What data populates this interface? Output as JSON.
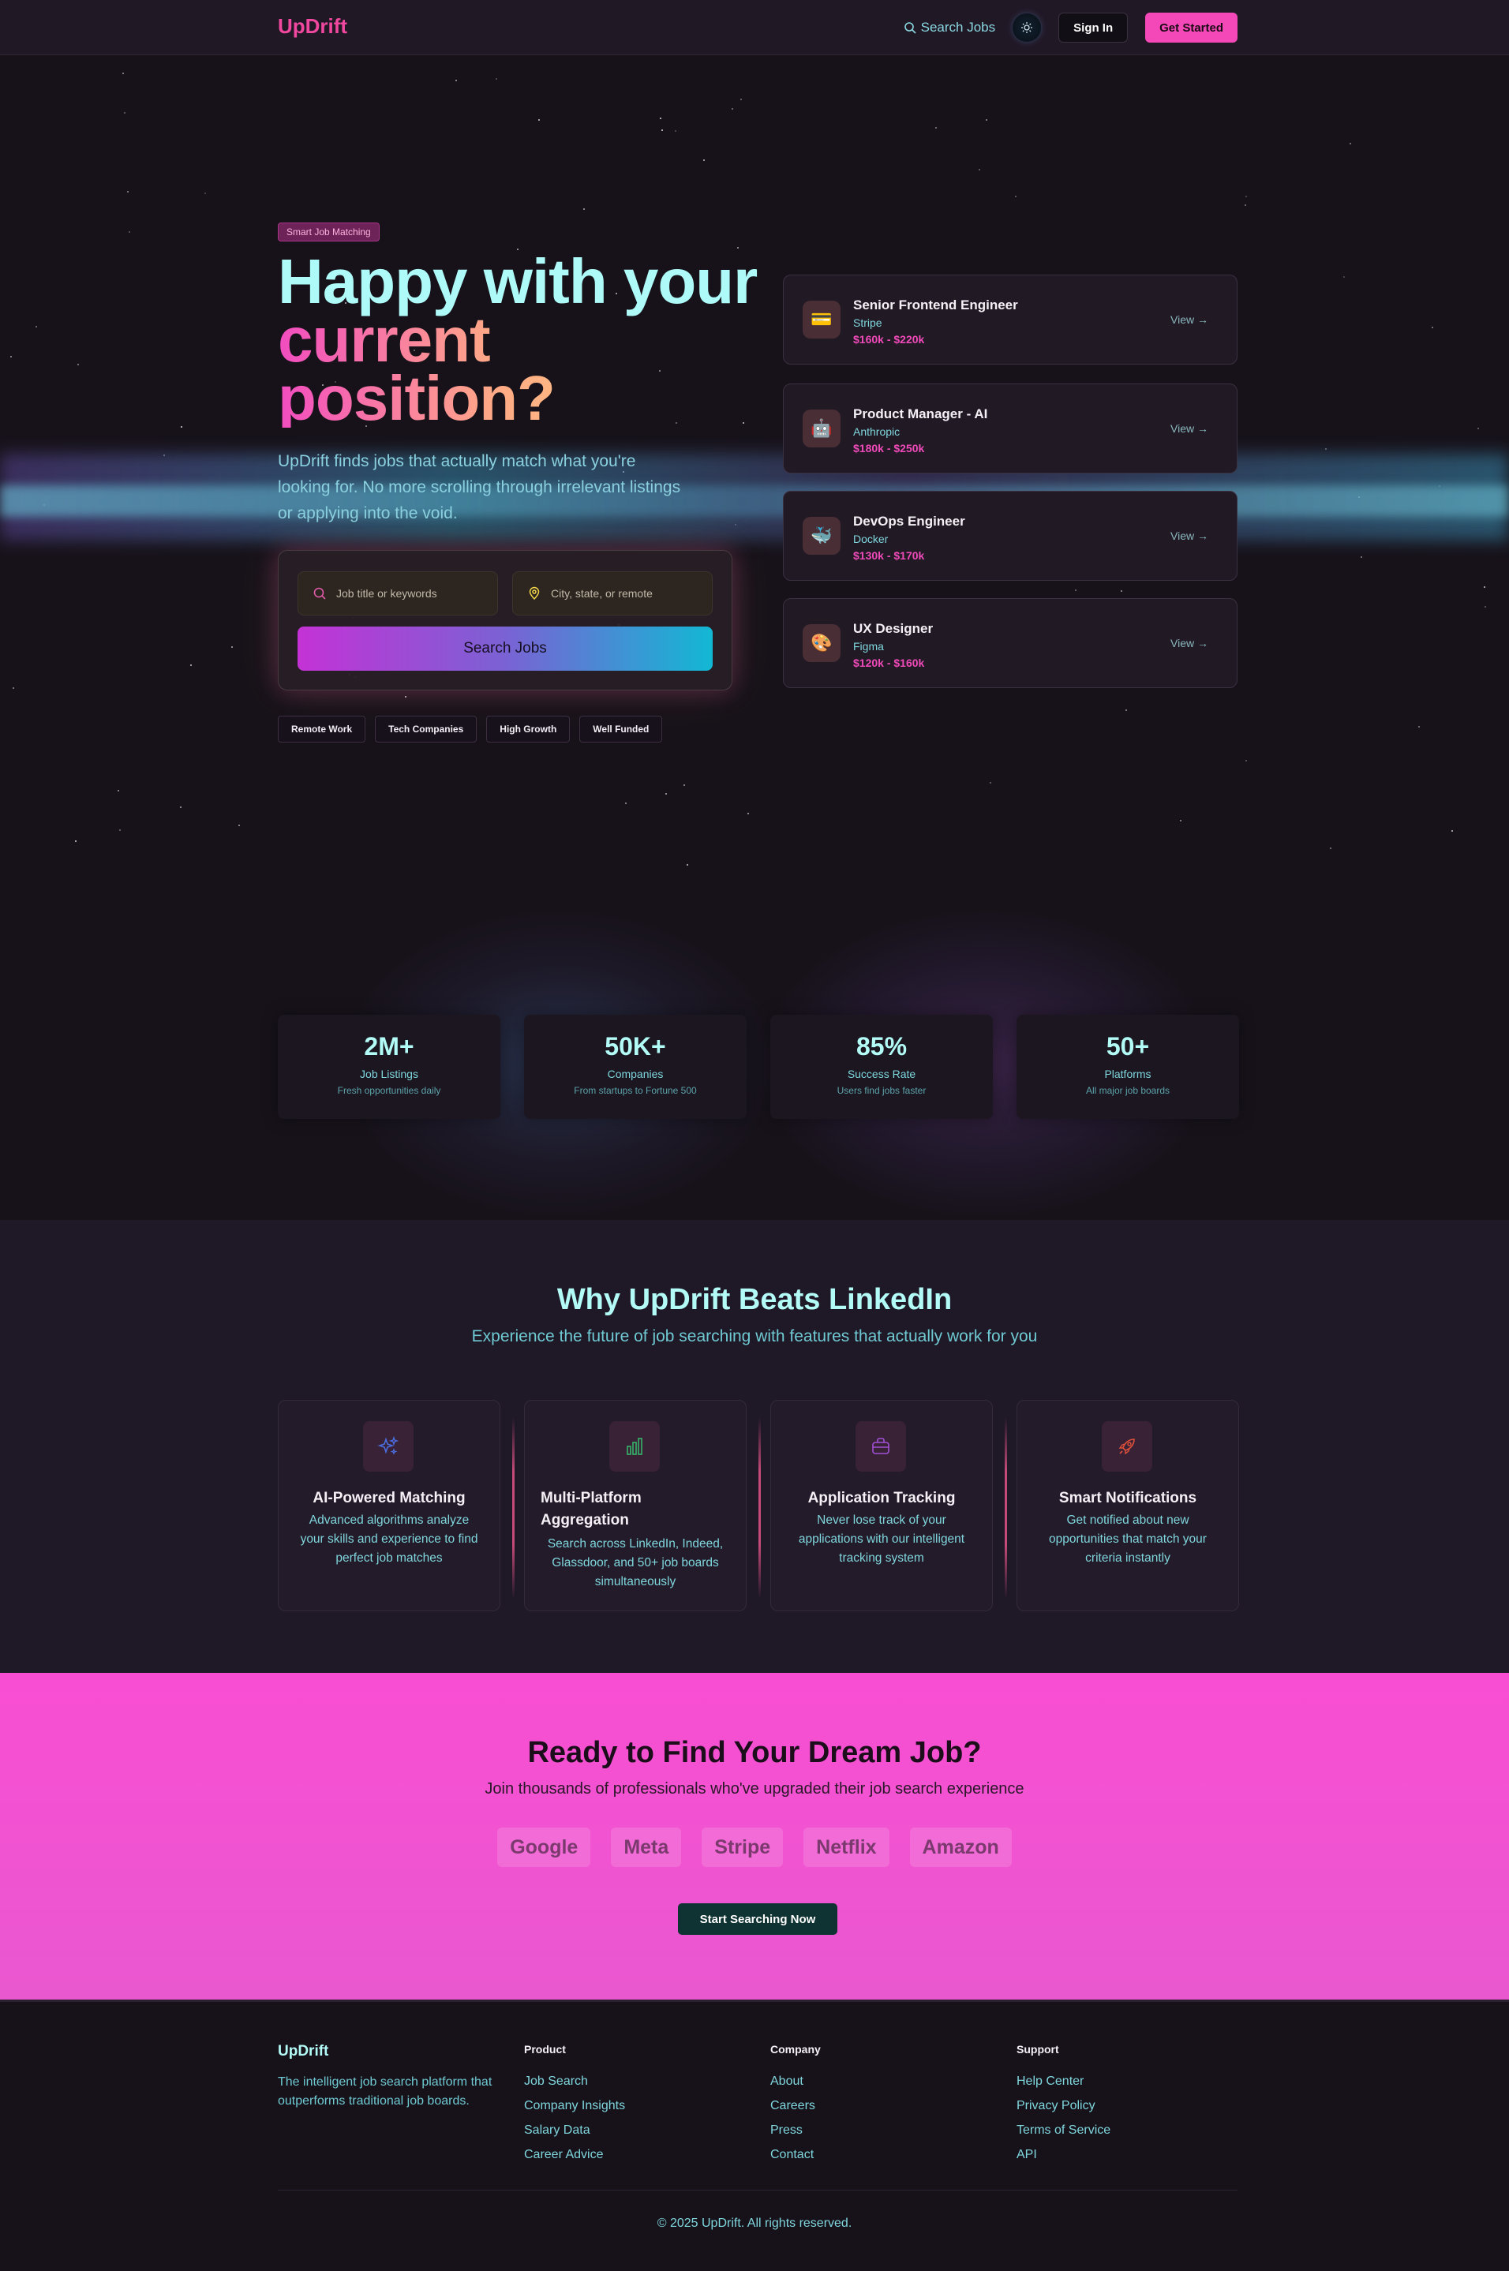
{
  "nav": {
    "logo": "UpDrift",
    "search_link": "Search Jobs",
    "sign_in": "Sign In",
    "get_started": "Get Started"
  },
  "hero": {
    "badge": "Smart Job Matching",
    "title_line1": "Happy with your",
    "title_line2": "current",
    "title_line3": "position?",
    "subtitle": "UpDrift finds jobs that actually match what you're looking for. No more scrolling through irrelevant listings or applying into the void.",
    "search": {
      "keywords_placeholder": "Job title or keywords",
      "location_placeholder": "City, state, or remote",
      "button": "Search Jobs"
    },
    "chips": [
      "Remote Work",
      "Tech Companies",
      "High Growth",
      "Well Funded"
    ]
  },
  "jobs": [
    {
      "title": "Senior Frontend Engineer",
      "company": "Stripe",
      "salary": "$160k - $220k",
      "view": "View →",
      "icon": "credit-card-icon",
      "emoji": "💳"
    },
    {
      "title": "Product Manager - AI",
      "company": "Anthropic",
      "salary": "$180k - $250k",
      "view": "View →",
      "icon": "robot-icon",
      "emoji": "🤖"
    },
    {
      "title": "DevOps Engineer",
      "company": "Docker",
      "salary": "$130k - $170k",
      "view": "View →",
      "icon": "whale-icon",
      "emoji": "🐳"
    },
    {
      "title": "UX Designer",
      "company": "Figma",
      "salary": "$120k - $160k",
      "view": "View →",
      "icon": "palette-icon",
      "emoji": "🎨"
    }
  ],
  "stats": [
    {
      "number": "2M+",
      "label": "Job Listings",
      "desc": "Fresh opportunities daily"
    },
    {
      "number": "50K+",
      "label": "Companies",
      "desc": "From startups to Fortune 500"
    },
    {
      "number": "85%",
      "label": "Success Rate",
      "desc": "Users find jobs faster"
    },
    {
      "number": "50+",
      "label": "Platforms",
      "desc": "All major job boards"
    }
  ],
  "features": {
    "title": "Why UpDrift Beats LinkedIn",
    "subtitle": "Experience the future of job searching with features that actually work for you",
    "cards": [
      {
        "title": "AI-Powered Matching",
        "desc": "Advanced algorithms analyze your skills and experience to find perfect job matches",
        "icon": "sparkles-icon",
        "color": "#4a6ee0"
      },
      {
        "title": "Multi-Platform Aggregation",
        "desc": "Search across LinkedIn, Indeed, Glassdoor, and 50+ job boards simultaneously",
        "icon": "bar-chart-icon",
        "color": "#36b36a"
      },
      {
        "title": "Application Tracking",
        "desc": "Never lose track of your applications with our intelligent tracking system",
        "icon": "briefcase-icon",
        "color": "#a04fd6"
      },
      {
        "title": "Smart Notifications",
        "desc": "Get notified about new opportunities that match your criteria instantly",
        "icon": "rocket-icon",
        "color": "#e0503a"
      }
    ]
  },
  "cta": {
    "title": "Ready to Find Your Dream Job?",
    "subtitle": "Join thousands of professionals who've upgraded their job search experience",
    "logos": [
      "Google",
      "Meta",
      "Stripe",
      "Netflix",
      "Amazon"
    ],
    "button": "Start Searching Now"
  },
  "footer": {
    "brand": "UpDrift",
    "desc": "The intelligent job search platform that outperforms traditional job boards.",
    "columns": [
      {
        "heading": "Product",
        "links": [
          "Job Search",
          "Company Insights",
          "Salary Data",
          "Career Advice"
        ]
      },
      {
        "heading": "Company",
        "links": [
          "About",
          "Careers",
          "Press",
          "Contact"
        ]
      },
      {
        "heading": "Support",
        "links": [
          "Help Center",
          "Privacy Policy",
          "Terms of Service",
          "API"
        ]
      }
    ],
    "copyright": "© 2025 UpDrift. All rights reserved."
  }
}
